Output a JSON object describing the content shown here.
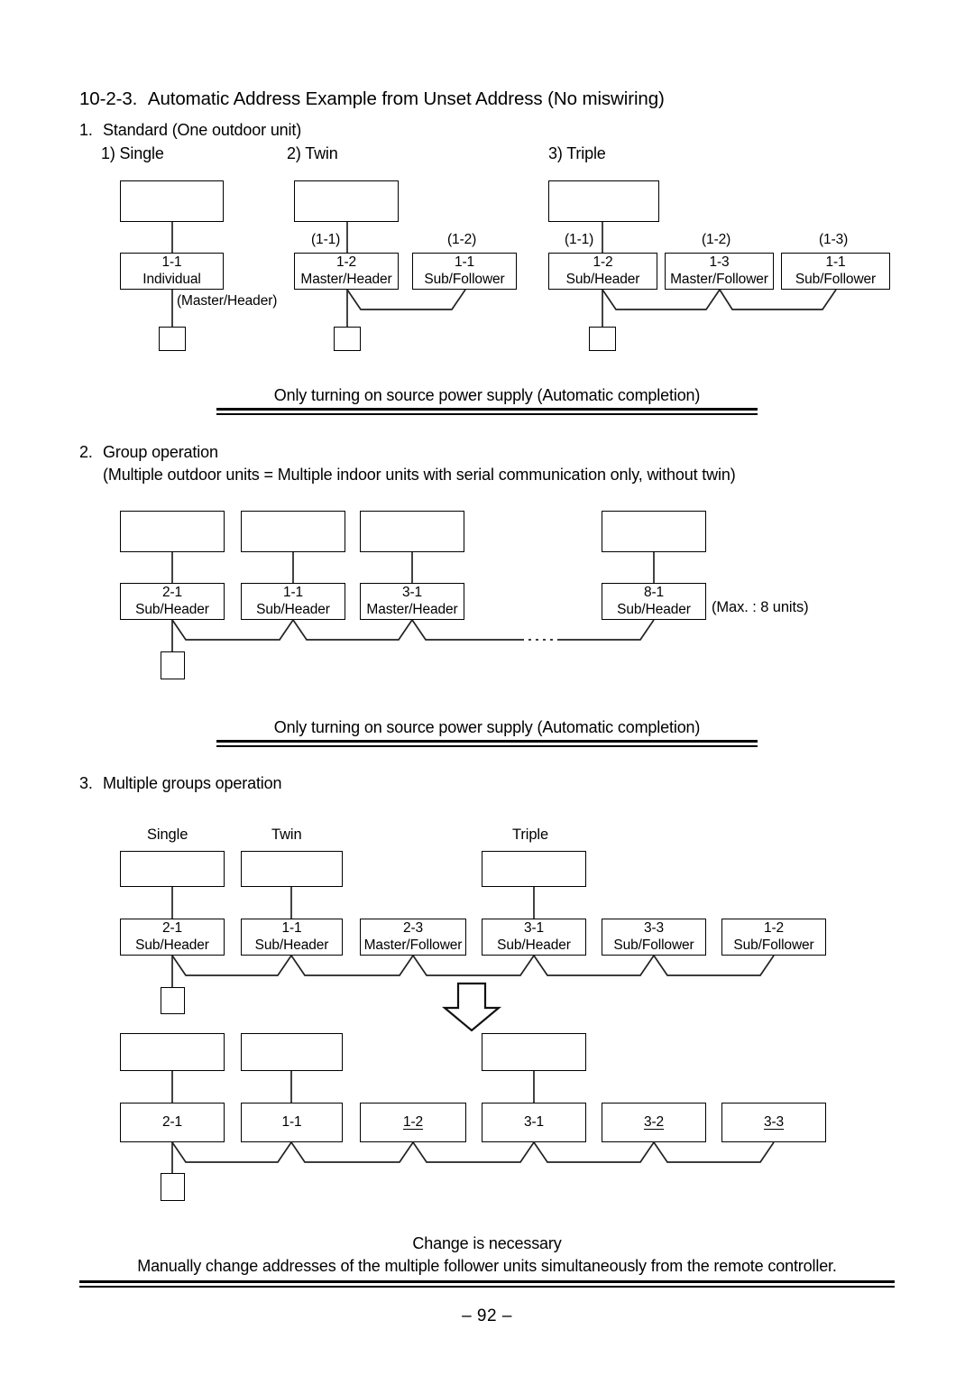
{
  "document": {
    "page_number": "– 92 –",
    "heading_number": "10-2-3.",
    "heading_text": "Automatic Address Example from Unset Address (No miswiring)"
  },
  "section1": {
    "number": "1.",
    "title": "Standard (One outdoor unit)",
    "subtitles": [
      {
        "label": "1) Single"
      },
      {
        "label": "2) Twin"
      },
      {
        "label": "3) Triple"
      }
    ],
    "single": {
      "indoor": [
        {
          "addr": "1-1",
          "role": "Individual",
          "tag": ""
        }
      ],
      "note": "(Master/Header)"
    },
    "twin": {
      "indoor": [
        {
          "addr": "1-2",
          "role": "Master/Header",
          "tag": "(1-1)"
        },
        {
          "addr": "1-1",
          "role": "Sub/Follower",
          "tag": "(1-2)"
        }
      ]
    },
    "triple": {
      "indoor": [
        {
          "addr": "1-2",
          "role": "Sub/Header",
          "tag": "(1-1)"
        },
        {
          "addr": "1-3",
          "role": "Master/Follower",
          "tag": "(1-2)"
        },
        {
          "addr": "1-1",
          "role": "Sub/Follower",
          "tag": "(1-3)"
        }
      ]
    },
    "caption": "Only turning on source power supply (Automatic completion)"
  },
  "section2": {
    "number": "2.",
    "title": "Group operation",
    "subtitle": "(Multiple outdoor units = Multiple indoor units with serial communication only, without twin)",
    "indoor": [
      {
        "addr": "2-1",
        "role": "Sub/Header"
      },
      {
        "addr": "1-1",
        "role": "Sub/Header"
      },
      {
        "addr": "3-1",
        "role": "Master/Header"
      },
      {
        "addr": "8-1",
        "role": "Sub/Header"
      }
    ],
    "max_note": "(Max. : 8 units)",
    "caption": "Only turning on source power supply (Automatic completion)"
  },
  "section3": {
    "number": "3.",
    "title": "Multiple groups operation",
    "group_labels": [
      {
        "label": "Single"
      },
      {
        "label": "Twin"
      },
      {
        "label": "Triple"
      }
    ],
    "before": [
      {
        "addr": "2-1",
        "role": "Sub/Header",
        "underline": false
      },
      {
        "addr": "1-1",
        "role": "Sub/Header",
        "underline": false
      },
      {
        "addr": "2-3",
        "role": "Master/Follower",
        "underline": false
      },
      {
        "addr": "3-1",
        "role": "Sub/Header",
        "underline": false
      },
      {
        "addr": "3-3",
        "role": "Sub/Follower",
        "underline": false
      },
      {
        "addr": "1-2",
        "role": "Sub/Follower",
        "underline": false
      }
    ],
    "after": [
      {
        "addr": "2-1",
        "role": "",
        "underline": false
      },
      {
        "addr": "1-1",
        "role": "",
        "underline": false
      },
      {
        "addr": "1-2",
        "role": "",
        "underline": true
      },
      {
        "addr": "3-1",
        "role": "",
        "underline": false
      },
      {
        "addr": "3-2",
        "role": "",
        "underline": true
      },
      {
        "addr": "3-3",
        "role": "",
        "underline": true
      }
    ],
    "arrow_icon": "down-arrow-icon",
    "footer_line1": "Change is necessary",
    "footer_line2": "Manually change addresses of the multiple follower units simultaneously from the remote controller."
  }
}
